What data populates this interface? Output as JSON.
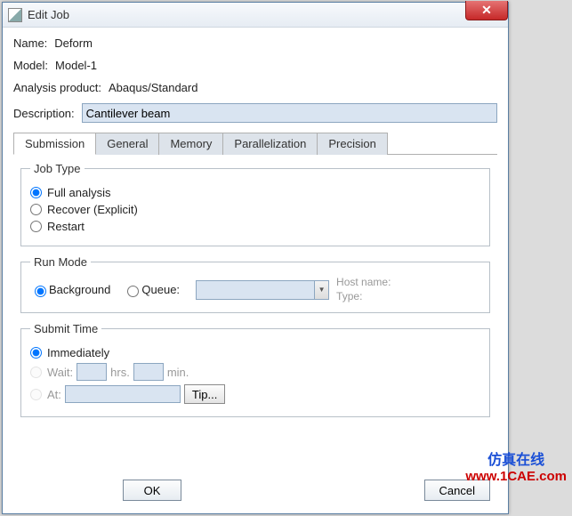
{
  "window": {
    "title": "Edit Job"
  },
  "fields": {
    "name_label": "Name:",
    "name_value": "Deform",
    "model_label": "Model:",
    "model_value": "Model-1",
    "product_label": "Analysis product:",
    "product_value": "Abaqus/Standard",
    "description_label": "Description:",
    "description_value": "Cantilever beam"
  },
  "tabs": {
    "submission": "Submission",
    "general": "General",
    "memory": "Memory",
    "parallelization": "Parallelization",
    "precision": "Precision"
  },
  "jobtype": {
    "legend": "Job Type",
    "full": "Full analysis",
    "recover": "Recover (Explicit)",
    "restart": "Restart"
  },
  "runmode": {
    "legend": "Run Mode",
    "background": "Background",
    "queue": "Queue:",
    "hostname_label": "Host name:",
    "type_label": "Type:"
  },
  "submittime": {
    "legend": "Submit Time",
    "immediately": "Immediately",
    "wait_label": "Wait:",
    "hrs": "hrs.",
    "min": "min.",
    "at_label": "At:",
    "tip": "Tip..."
  },
  "buttons": {
    "ok": "OK",
    "cancel": "Cancel"
  },
  "watermark": {
    "center": "1CAE.COM",
    "cn": "仿真在线",
    "url": "www.1CAE.com"
  }
}
